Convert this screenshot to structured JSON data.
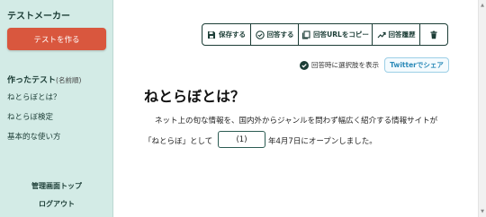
{
  "sidebar": {
    "app_title": "テストメーカー",
    "create_button": "テストを作る",
    "section_title": "作ったテスト",
    "section_subtitle": "(名前順)",
    "items": [
      "ねとらぼとは？",
      "ねとらぼ検定",
      "基本的な使い方"
    ],
    "admin_top": "管理画面トップ",
    "logout": "ログアウト"
  },
  "toolbar": {
    "save": "保存する",
    "answer": "回答する",
    "copy_url": "回答URLをコピー",
    "history": "回答履歴",
    "delete_icon": "trash-icon"
  },
  "options": {
    "show_choices_label": "回答時に選択肢を表示",
    "show_choices_checked": true,
    "share_button": "Twitterでシェア"
  },
  "content": {
    "title": "ねとらぼとは？",
    "line1": "ネット上の旬な情報を、国内外からジャンルを問わず幅広く紹介する情報サイトが",
    "line2_before": "「ねとらぼ」として",
    "blank_label": "(1)",
    "line2_after": "年4月7日にオープンしました。"
  },
  "colors": {
    "sidebar_bg": "#d3ebe6",
    "accent_red": "#d9573e",
    "dark_green": "#1c3d36",
    "twitter_blue": "#2a8ab8"
  }
}
